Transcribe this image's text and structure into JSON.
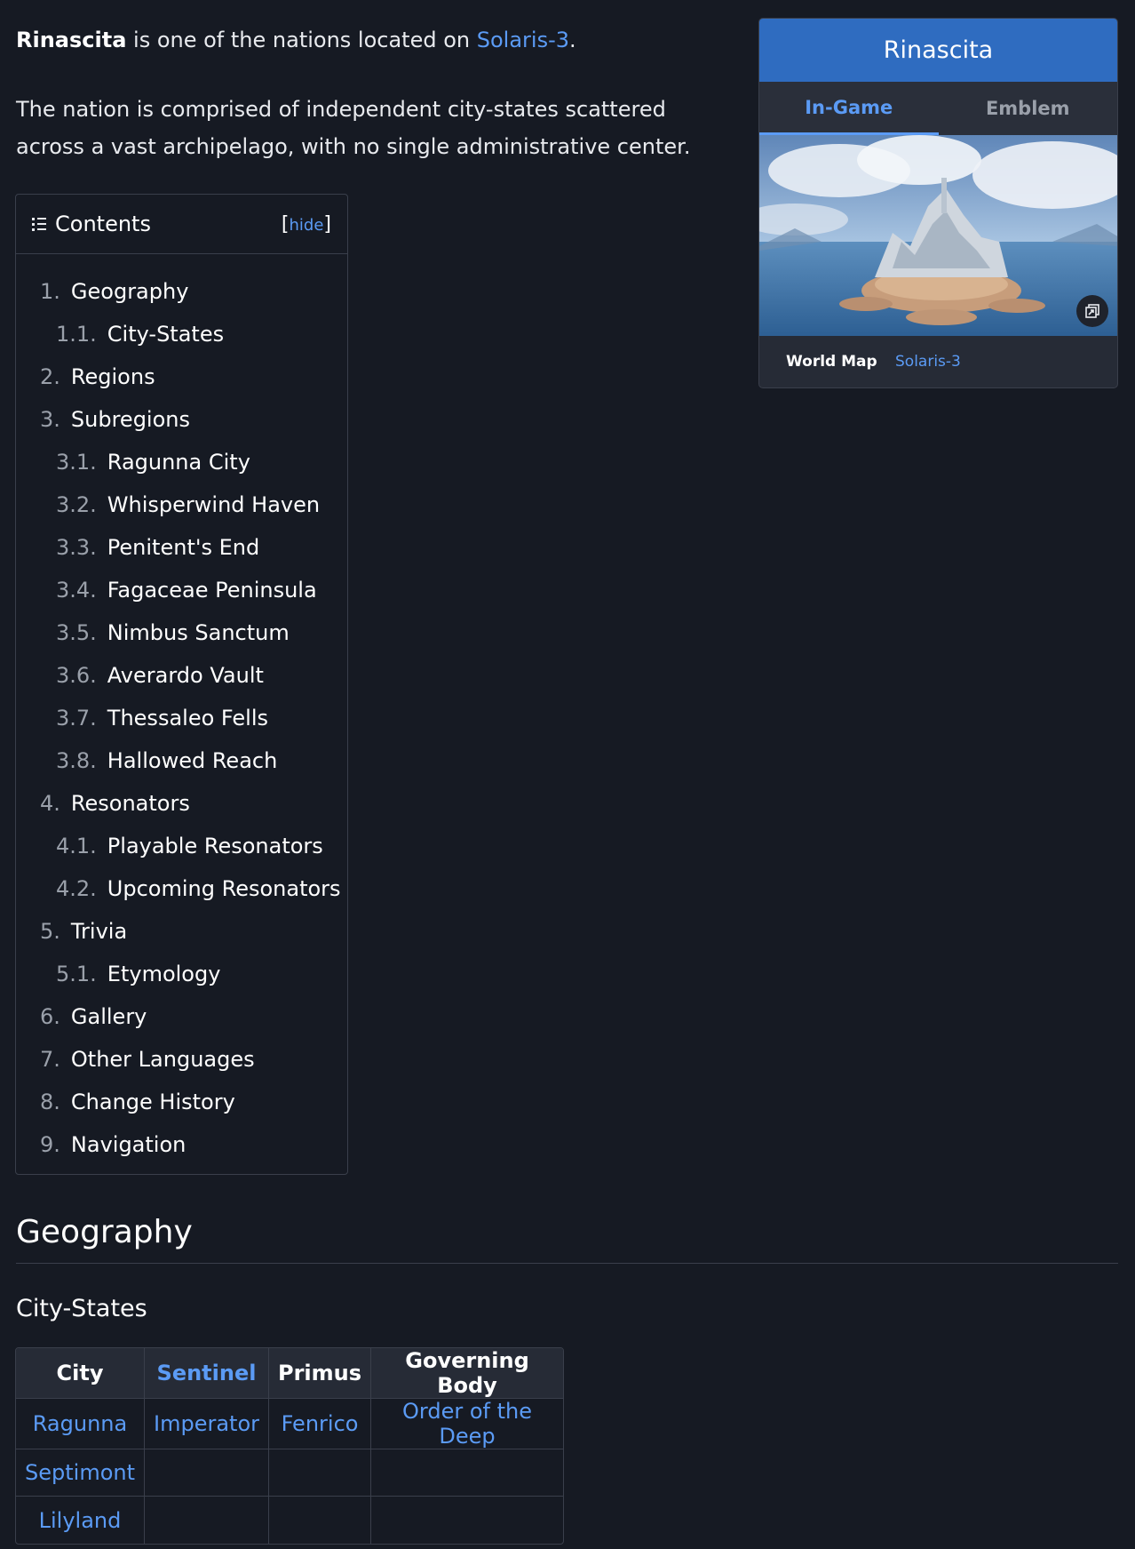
{
  "intro": {
    "bold_name": "Rinascita",
    "sentence1_mid": " is one of the nations located on ",
    "sentence1_link": "Solaris-3",
    "sentence1_end": ".",
    "paragraph2": "The nation is comprised of independent city-states scattered across a vast archipelago, with no single administrative center."
  },
  "toc": {
    "title": "Contents",
    "hide_label": "hide",
    "items": [
      {
        "num": "1.",
        "text": "Geography",
        "level": 1
      },
      {
        "num": "1.1.",
        "text": "City-States",
        "level": 2
      },
      {
        "num": "2.",
        "text": "Regions",
        "level": 1
      },
      {
        "num": "3.",
        "text": "Subregions",
        "level": 1
      },
      {
        "num": "3.1.",
        "text": "Ragunna City",
        "level": 2
      },
      {
        "num": "3.2.",
        "text": "Whisperwind Haven",
        "level": 2
      },
      {
        "num": "3.3.",
        "text": "Penitent's End",
        "level": 2
      },
      {
        "num": "3.4.",
        "text": "Fagaceae Peninsula",
        "level": 2
      },
      {
        "num": "3.5.",
        "text": "Nimbus Sanctum",
        "level": 2
      },
      {
        "num": "3.6.",
        "text": "Averardo Vault",
        "level": 2
      },
      {
        "num": "3.7.",
        "text": "Thessaleo Fells",
        "level": 2
      },
      {
        "num": "3.8.",
        "text": "Hallowed Reach",
        "level": 2
      },
      {
        "num": "4.",
        "text": "Resonators",
        "level": 1
      },
      {
        "num": "4.1.",
        "text": "Playable Resonators",
        "level": 2
      },
      {
        "num": "4.2.",
        "text": "Upcoming Resonators",
        "level": 2
      },
      {
        "num": "5.",
        "text": "Trivia",
        "level": 1
      },
      {
        "num": "5.1.",
        "text": "Etymology",
        "level": 2
      },
      {
        "num": "6.",
        "text": "Gallery",
        "level": 1
      },
      {
        "num": "7.",
        "text": "Other Languages",
        "level": 1
      },
      {
        "num": "8.",
        "text": "Change History",
        "level": 1
      },
      {
        "num": "9.",
        "text": "Navigation",
        "level": 1
      }
    ]
  },
  "infobox": {
    "title": "Rinascita",
    "tabs": [
      "In-Game",
      "Emblem"
    ],
    "active_tab": "In-Game",
    "image_icon": "expand-icon",
    "world_map_label": "World Map",
    "world_map_value": "Solaris-3"
  },
  "section": {
    "heading": "Geography",
    "subheading": "City-States"
  },
  "table": {
    "headers": [
      "City",
      "Sentinel",
      "Primus",
      "Governing Body"
    ],
    "sorted_column": "Sentinel",
    "rows": [
      [
        "Ragunna",
        "Imperator",
        "Fenrico",
        "Order of the Deep"
      ],
      [
        "Septimont",
        "",
        "",
        ""
      ],
      [
        "Lilyland",
        "",
        "",
        ""
      ]
    ]
  },
  "colors": {
    "background": "#161a23",
    "link": "#5b9bf5",
    "infobox_header": "#2f6cc0",
    "border": "#3a3f4b"
  }
}
